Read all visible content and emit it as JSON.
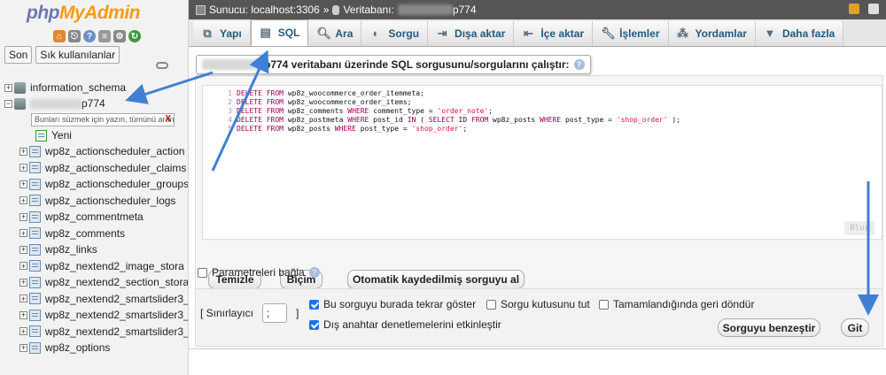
{
  "logo": {
    "part1": "php",
    "part2": "MyAdmin"
  },
  "left": {
    "tabs": [
      "Son",
      "Sık kullanılanlar"
    ],
    "filter_tip": "Bunları süzmek için yazın, tümünü aran",
    "filter_clear": "X",
    "tree": {
      "db1": "information_schema",
      "db2_suffix": "p774",
      "new": "Yeni",
      "tables": [
        "wp8z_actionscheduler_action",
        "wp8z_actionscheduler_claims",
        "wp8z_actionscheduler_groups",
        "wp8z_actionscheduler_logs",
        "wp8z_commentmeta",
        "wp8z_comments",
        "wp8z_links",
        "wp8z_nextend2_image_stora",
        "wp8z_nextend2_section_stora",
        "wp8z_nextend2_smartslider3_",
        "wp8z_nextend2_smartslider3_",
        "wp8z_nextend2_smartslider3_",
        "wp8z_options"
      ]
    }
  },
  "breadcrumb": {
    "server": "Sunucu: localhost:3306",
    "sep": "»",
    "db_label": "Veritabanı:",
    "db_suffix": "p774"
  },
  "tabs": [
    {
      "label": "Yapı",
      "icon": "structure-icon"
    },
    {
      "label": "SQL",
      "icon": "sql-icon"
    },
    {
      "label": "Ara",
      "icon": "search-icon"
    },
    {
      "label": "Sorgu",
      "icon": "query-icon"
    },
    {
      "label": "Dışa aktar",
      "icon": "export-icon"
    },
    {
      "label": "İçe aktar",
      "icon": "import-icon"
    },
    {
      "label": "İşlemler",
      "icon": "wrench-icon"
    },
    {
      "label": "Yordamlar",
      "icon": "routines-icon"
    },
    {
      "label": "Daha fazla",
      "icon": "caret-down-icon"
    }
  ],
  "query": {
    "title_suffix": "p774 veritabanı üzerinde SQL sorgusunu/sorgularını çalıştır:",
    "lines": [
      "DELETE FROM wp8z_woocommerce_order_itemmeta;",
      "DELETE FROM wp8z_woocommerce_order_items;",
      "DELETE FROM wp8z_comments WHERE comment_type = 'order_note';",
      "DELETE FROM wp8z_postmeta WHERE post_id IN ( SELECT ID FROM wp8z_posts WHERE post_type = 'shop_order' );",
      "DELETE FROM wp8z_posts WHERE post_type = 'shop_order';"
    ],
    "blur_label": "Blur",
    "buttons": {
      "clear": "Temizle",
      "format": "Biçim",
      "autosaved": "Otomatik kaydedilmiş sorguyu al"
    },
    "bind_params": "Parametreleri bağla"
  },
  "options": {
    "delimiter_label_open": "[ Sınırlayıcı",
    "delimiter_value": ";",
    "delimiter_label_close": "]",
    "show_again": {
      "label": "Bu sorguyu burada tekrar göster",
      "checked": true
    },
    "keep_box": {
      "label": "Sorgu kutusunu tut",
      "checked": false
    },
    "rollback": {
      "label": "Tamamlandığında geri döndür",
      "checked": false
    },
    "fk_checks": {
      "label": "Dış anahtar denetlemelerini etkinleştir",
      "checked": true
    },
    "simulate": "Sorguyu benzeştir",
    "go": "Git"
  },
  "colors": {
    "arrow": "#3f7fd6",
    "link": "#235a81",
    "topbar": "#555555"
  }
}
